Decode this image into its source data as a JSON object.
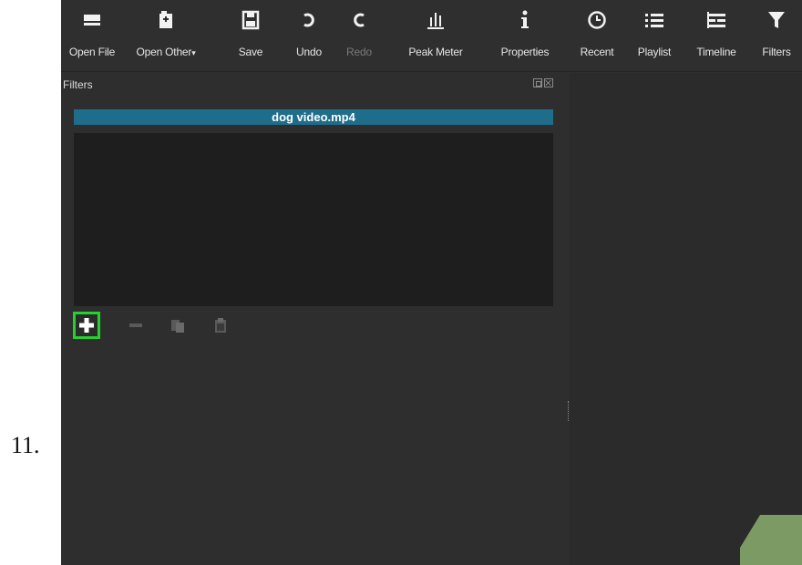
{
  "step": {
    "number": "11."
  },
  "toolbar": {
    "buttons": [
      {
        "label": "Open File",
        "icon": "open-file-icon"
      },
      {
        "label": "Open Other",
        "icon": "open-other-icon"
      },
      {
        "label": "Save",
        "icon": "save-icon"
      },
      {
        "label": "Undo",
        "icon": "undo-icon"
      },
      {
        "label": "Redo",
        "icon": "redo-icon",
        "disabled": true
      },
      {
        "label": "Peak Meter",
        "icon": "peak-meter-icon"
      },
      {
        "label": "Properties",
        "icon": "properties-icon"
      },
      {
        "label": "Recent",
        "icon": "recent-icon"
      },
      {
        "label": "Playlist",
        "icon": "playlist-icon"
      },
      {
        "label": "Timeline",
        "icon": "timeline-icon"
      },
      {
        "label": "Filters",
        "icon": "filter-icon"
      }
    ]
  },
  "filters_panel": {
    "title": "Filters",
    "clip_name": "dog video.mp4",
    "actions": [
      {
        "name": "add",
        "icon": "plus-icon",
        "highlighted": true
      },
      {
        "name": "remove",
        "icon": "minus-icon"
      },
      {
        "name": "copy",
        "icon": "copy-icon"
      },
      {
        "name": "paste",
        "icon": "paste-icon"
      }
    ]
  },
  "colors": {
    "background": "#2e2e2e",
    "clip_header": "#1e6d8a",
    "highlight": "#25d02f",
    "corner_shape": "#7c9a64"
  }
}
